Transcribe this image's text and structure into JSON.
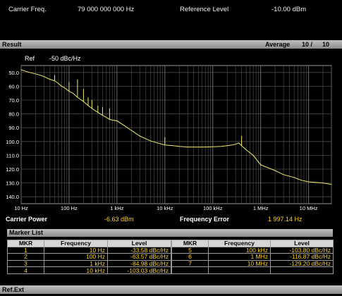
{
  "header": {
    "carrier_label": "Carrier Freq.",
    "carrier_value": "79 000 000 000 Hz",
    "ref_level_label": "Reference Level",
    "ref_level_value": "-10.00 dBm"
  },
  "result_bar": {
    "title": "Result",
    "average_label": "Average",
    "average_current": "10 /",
    "average_total": "10"
  },
  "ref": {
    "label": "Ref",
    "value": "-50 dBc/Hz"
  },
  "colors": {
    "trace": "#f0ec6a",
    "value": "#ffd21e",
    "bar": "#a6a6a6",
    "grid": "#4a4a4a"
  },
  "chart_data": {
    "type": "line",
    "x_scale": "log",
    "xlim": [
      10,
      30000000
    ],
    "ylim": [
      -145,
      -45
    ],
    "y_ticks": [
      "50.0",
      "60.0",
      "70.0",
      "80.0",
      "90.0",
      "100.0",
      "110.0",
      "120.0",
      "130.0",
      "140.0"
    ],
    "y_tick_values": [
      -50,
      -60,
      -70,
      -80,
      -90,
      -100,
      -110,
      -120,
      -130,
      -140
    ],
    "x_ticks": [
      "10 Hz",
      "100 Hz",
      "1 kHz",
      "10 kHz",
      "100 kHz",
      "1 MHz",
      "10 MHz"
    ],
    "x_tick_values": [
      10,
      100,
      1000,
      10000,
      100000,
      1000000,
      10000000
    ],
    "series": [
      {
        "x": [
          10,
          12,
          15,
          20,
          25,
          30,
          40,
          50,
          60,
          70,
          80,
          100,
          120,
          150,
          200,
          250,
          300,
          400,
          500,
          600,
          700,
          800,
          1000,
          1500,
          2000,
          3000,
          4000,
          5000,
          7000,
          10000,
          15000,
          20000,
          30000,
          50000,
          70000,
          100000,
          150000,
          200000,
          250000,
          300000,
          350000,
          400000,
          500000,
          700000,
          1000000,
          2000000,
          3000000,
          5000000,
          7000000,
          10000000,
          20000000,
          30000000
        ],
        "y": [
          -48,
          -49,
          -50,
          -51,
          -52,
          -53,
          -55,
          -56,
          -58,
          -60,
          -61,
          -63.6,
          -65,
          -68,
          -71,
          -74,
          -76,
          -79,
          -81,
          -82.5,
          -84,
          -84.5,
          -85,
          -89,
          -92,
          -96,
          -98,
          -99.5,
          -101,
          -102.5,
          -103,
          -103.5,
          -104,
          -104,
          -104,
          -103.8,
          -103.5,
          -103,
          -102.5,
          -102,
          -101,
          -103,
          -106,
          -110,
          -116.9,
          -121,
          -124,
          -126,
          -128,
          -129.2,
          -130,
          -131
        ],
        "spurs": [
          {
            "x": 50,
            "y": -52
          },
          {
            "x": 100,
            "y": -57
          },
          {
            "x": 150,
            "y": -55
          },
          {
            "x": 200,
            "y": -62
          },
          {
            "x": 250,
            "y": -68
          },
          {
            "x": 300,
            "y": -70
          },
          {
            "x": 400,
            "y": -74
          },
          {
            "x": 500,
            "y": -75
          },
          {
            "x": 700,
            "y": -76
          },
          {
            "x": 10000,
            "y": -97
          },
          {
            "x": 400000,
            "y": -96
          }
        ]
      }
    ]
  },
  "measurements": {
    "carrier_power_label": "Carrier Power",
    "carrier_power_value": "-6.63 dBm",
    "freq_error_label": "Frequency Error",
    "freq_error_value": "1 997.14 Hz"
  },
  "marker_list": {
    "title": "Marker List",
    "columns": [
      "MKR",
      "Frequency",
      "Level"
    ],
    "left": [
      {
        "mkr": "1",
        "freq": "10 Hz",
        "level": "-33.58 dBc/Hz"
      },
      {
        "mkr": "2",
        "freq": "100 Hz",
        "level": "-63.57 dBc/Hz"
      },
      {
        "mkr": "3",
        "freq": "1 kHz",
        "level": "-84.98 dBc/Hz"
      },
      {
        "mkr": "4",
        "freq": "10 kHz",
        "level": "-103.03 dBc/Hz"
      }
    ],
    "right": [
      {
        "mkr": "5",
        "freq": "100 kHz",
        "level": "-103.80 dBc/Hz"
      },
      {
        "mkr": "6",
        "freq": "1 MHz",
        "level": "-116.87 dBc/Hz"
      },
      {
        "mkr": "7",
        "freq": "10 MHz",
        "level": "-129.20 dBc/Hz"
      },
      {
        "mkr": "",
        "freq": "",
        "level": ""
      }
    ]
  },
  "footer": {
    "label": "Ref.Ext"
  }
}
